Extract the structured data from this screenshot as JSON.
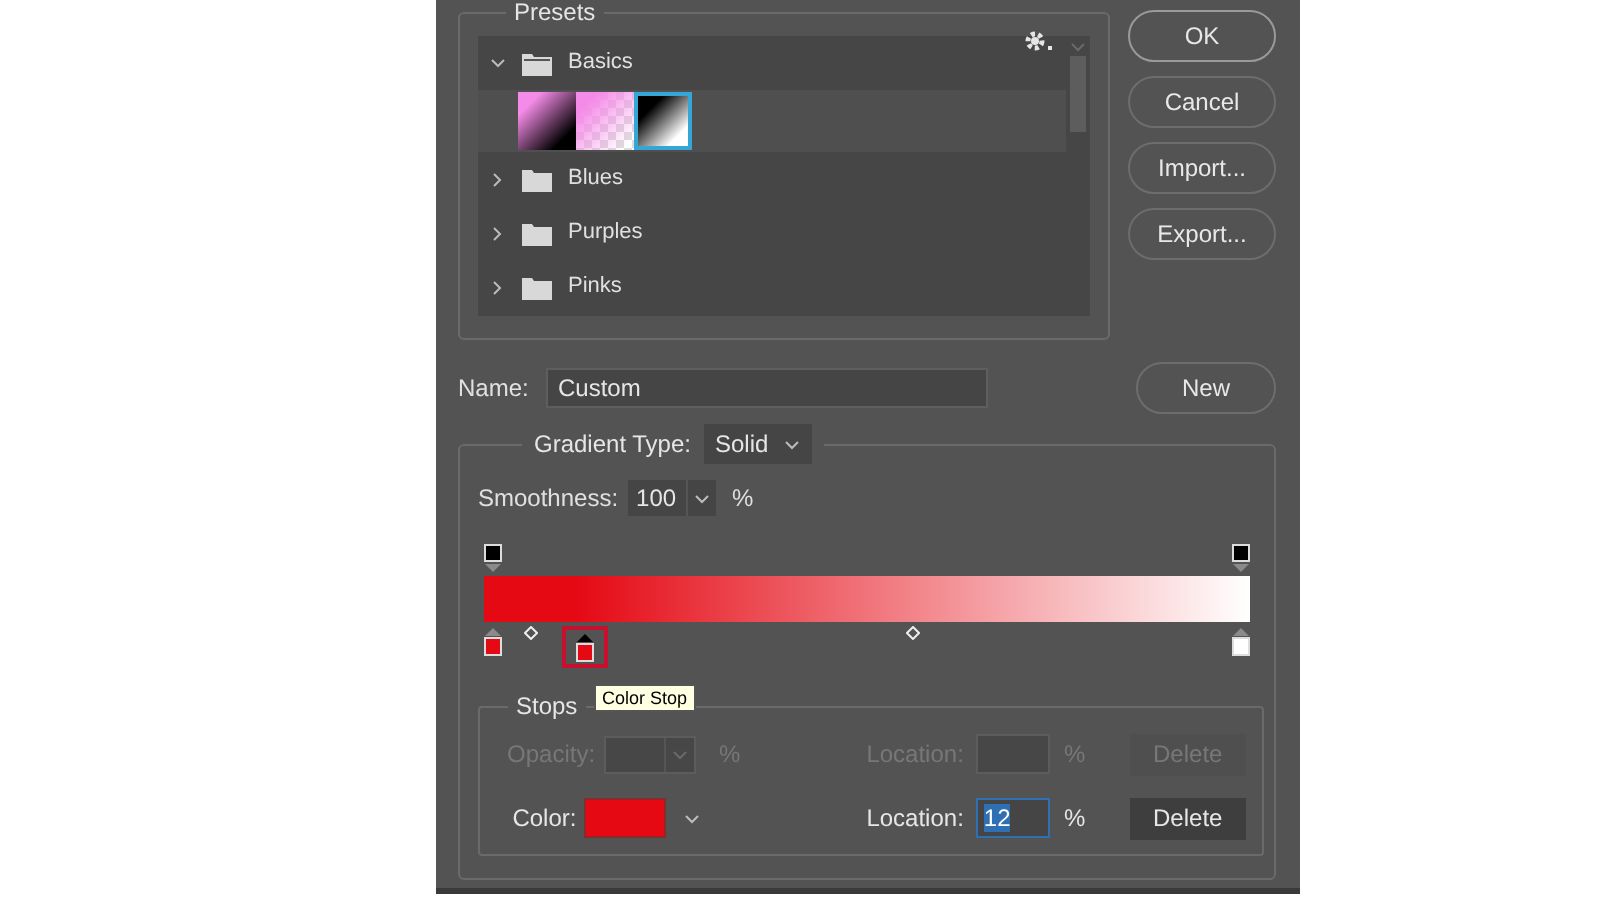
{
  "presets": {
    "title": "Presets",
    "folders": [
      {
        "name": "Basics",
        "expanded": true,
        "swatches": [
          {
            "kind": "foreground",
            "selected": false
          },
          {
            "kind": "transparent",
            "selected": false
          },
          {
            "kind": "blackwhite",
            "selected": true
          }
        ]
      },
      {
        "name": "Blues",
        "expanded": false
      },
      {
        "name": "Purples",
        "expanded": false
      },
      {
        "name": "Pinks",
        "expanded": false
      }
    ]
  },
  "buttons": [
    {
      "label": "OK"
    },
    {
      "label": "Cancel"
    },
    {
      "label": "Import..."
    },
    {
      "label": "Export..."
    }
  ],
  "name_field": {
    "label": "Name:",
    "value": "Custom"
  },
  "new_button": "New",
  "gradient": {
    "type_label": "Gradient Type:",
    "type_value": "Solid",
    "smoothness_label": "Smoothness:",
    "smoothness_value": "100",
    "smoothness_unit": "%",
    "opacity_stops": [
      {
        "selected": false
      },
      {
        "selected": false
      }
    ],
    "color_stops": [
      {
        "color": "#e50914",
        "selected": false
      },
      {
        "color": "#e50914",
        "selected": true
      },
      {
        "color": "#ffffff",
        "selected": false
      }
    ],
    "tooltip": "Color Stop"
  },
  "stops": {
    "title": "Stops",
    "rows": [
      {
        "kind": "opacity",
        "label": "Opacity:",
        "unit": "%",
        "location_label": "Location:",
        "location_unit": "%",
        "button": "Delete",
        "disabled": true
      },
      {
        "kind": "color",
        "label": "Color:",
        "color": "#e50914",
        "location_label": "Location:",
        "location_value": "12",
        "location_unit": "%",
        "button": "Delete",
        "disabled": false
      }
    ]
  }
}
